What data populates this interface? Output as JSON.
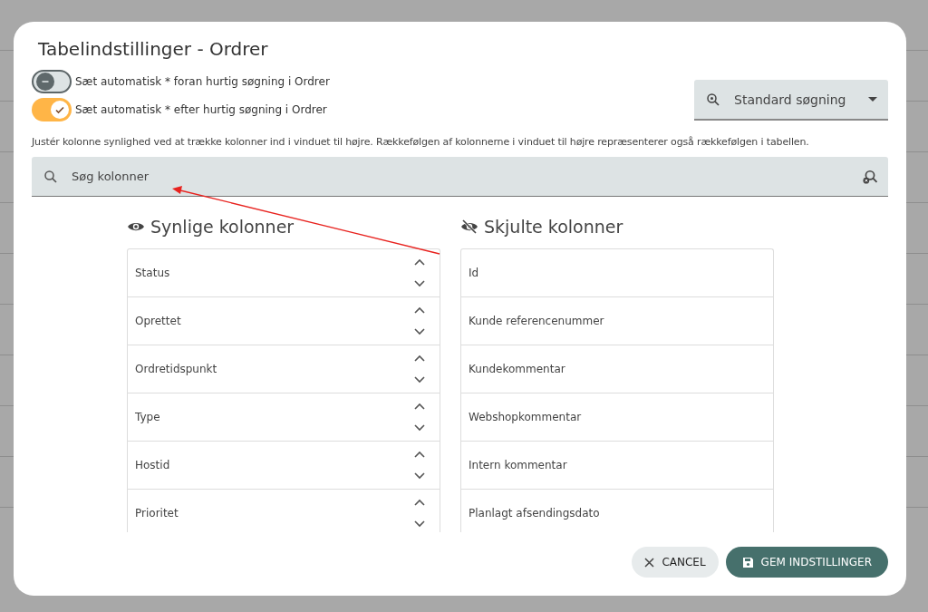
{
  "dialog": {
    "title": "Tabelindstillinger - Ordrer",
    "toggles": [
      {
        "label": "Sæt automatisk * foran hurtig søgning i Ordrer",
        "on": false
      },
      {
        "label": "Sæt automatisk * efter hurtig søgning i Ordrer",
        "on": true
      }
    ],
    "search_mode": {
      "value": "Standard søgning"
    },
    "help_text": "Justér kolonne synlighed ved at trække kolonner ind i vinduet til højre. Rækkefølgen af kolonnerne i vinduet til højre repræsenterer også rækkefølgen i tabellen.",
    "column_search": {
      "placeholder": "Søg kolonner"
    },
    "visible_columns": {
      "title": "Synlige kolonner",
      "items": [
        "Status",
        "Oprettet",
        "Ordretidspunkt",
        "Type",
        "Hostid",
        "Prioritet"
      ]
    },
    "hidden_columns": {
      "title": "Skjulte kolonner",
      "items": [
        "Id",
        "Kunde referencenummer",
        "Kundekommentar",
        "Webshopkommentar",
        "Intern kommentar",
        "Planlagt afsendingsdato"
      ]
    },
    "buttons": [
      {
        "label": "CANCEL",
        "kind": "secondary"
      },
      {
        "label": "GEM INDSTILLINGER",
        "kind": "primary"
      }
    ]
  }
}
